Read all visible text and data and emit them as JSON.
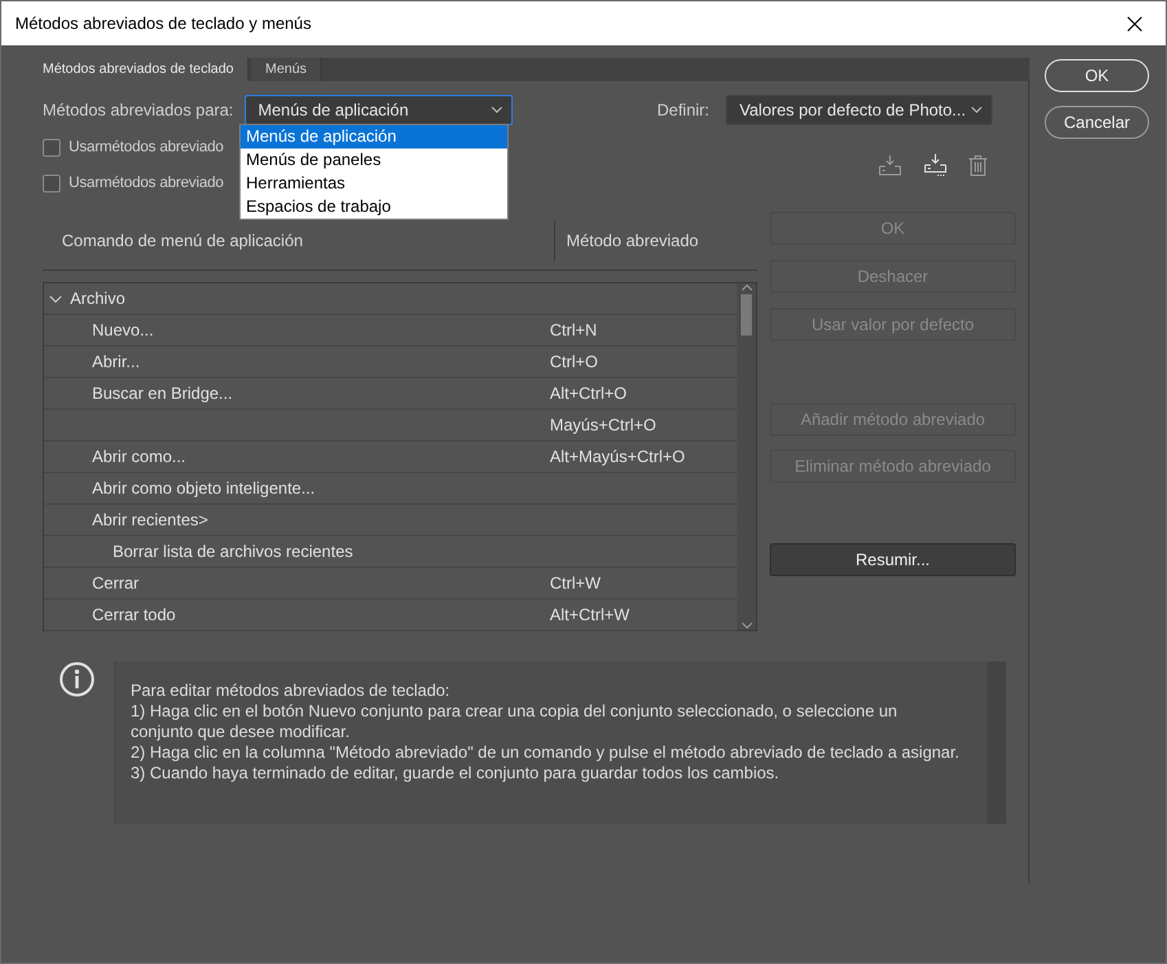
{
  "window": {
    "title": "Métodos abreviados de teclado y menús"
  },
  "tabs": [
    {
      "label": "Métodos abreviados de teclado",
      "selected": true
    },
    {
      "label": "Menús",
      "selected": false
    }
  ],
  "shortcuts_for": {
    "label": "Métodos abreviados para:",
    "value": "Menús de aplicación",
    "options": [
      {
        "label": "Menús de aplicación",
        "selected": true
      },
      {
        "label": "Menús de paneles",
        "selected": false
      },
      {
        "label": "Herramientas",
        "selected": false
      },
      {
        "label": "Espacios de trabajo",
        "selected": false
      }
    ]
  },
  "set": {
    "label": "Definir:",
    "value": "Valores por defecto de Photo..."
  },
  "checkboxes": [
    {
      "label": "Usarmétodos abreviado",
      "checked": false
    },
    {
      "label": "Usarmétodos abreviado",
      "checked": false
    }
  ],
  "table": {
    "columns": [
      "Comando de menú de aplicación",
      "Método abreviado"
    ],
    "groups": [
      {
        "label": "Archivo",
        "expanded": true,
        "children": [
          {
            "command": "Nuevo...",
            "shortcut": "Ctrl+N"
          },
          {
            "command": "Abrir...",
            "shortcut": "Ctrl+O"
          },
          {
            "command": "Buscar en Bridge...",
            "shortcut": "Alt+Ctrl+O"
          },
          {
            "shortcut": "Mayús+Ctrl+O"
          },
          {
            "command": "Abrir como...",
            "shortcut": "Alt+Mayús+Ctrl+O"
          },
          {
            "command": "Abrir como objeto inteligente..."
          },
          {
            "command": "Abrir recientes>",
            "children": [
              {
                "command": "Borrar lista de archivos recientes"
              }
            ]
          },
          {
            "command": "Cerrar",
            "shortcut": "Ctrl+W"
          },
          {
            "command": "Cerrar todo",
            "shortcut": "Alt+Ctrl+W"
          }
        ]
      }
    ]
  },
  "side_buttons": [
    {
      "label": "OK",
      "disabled": true,
      "kind": "top"
    },
    {
      "label": "Deshacer",
      "disabled": true,
      "kind": "top"
    },
    {
      "label": "Usar valor por defecto",
      "disabled": true,
      "kind": "top"
    },
    {
      "label": "Añadir método abreviado",
      "disabled": true,
      "kind": "middle"
    },
    {
      "label": "Eliminar método abreviado",
      "disabled": true,
      "kind": "middle"
    },
    {
      "label": "Resumir...",
      "disabled": false,
      "kind": "bottom"
    }
  ],
  "dialog_buttons": [
    {
      "label": "OK",
      "default": true
    },
    {
      "label": "Cancelar",
      "default": false
    }
  ],
  "info": {
    "lines": [
      "Para editar métodos abreviados de teclado:",
      "1) Haga clic en el botón Nuevo conjunto para crear una copia del conjunto seleccionado, o seleccione un conjunto que desee modificar.",
      "2) Haga clic en la columna \"Método abreviado\" de un comando y pulse el método abreviado de teclado a asignar.",
      "3) Cuando haya terminado de editar, guarde el conjunto para guardar todos los cambios."
    ]
  }
}
